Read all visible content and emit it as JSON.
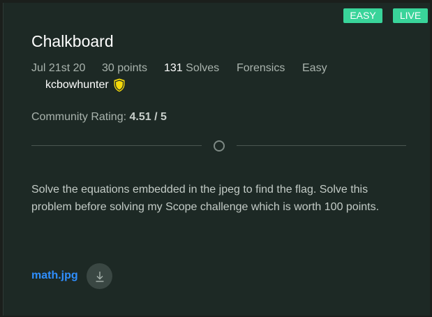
{
  "badges": {
    "easy": "EASY",
    "live": "LIVE"
  },
  "challenge": {
    "title": "Chalkboard",
    "date": "Jul 21st 20",
    "points": "30 points",
    "solves_count": "131",
    "solves_label": "Solves",
    "category": "Forensics",
    "difficulty": "Easy",
    "author": "kcbowhunter",
    "rating_label": "Community Rating:",
    "rating_value": "4.51 / 5",
    "description": "Solve the equations embedded in the jpeg to find the flag. Solve this problem before solving my Scope challenge which is worth 100 points.",
    "file_name": "math.jpg"
  },
  "icons": {
    "author_badge": "shield-icon",
    "download": "download-icon",
    "divider": "circle-icon"
  },
  "colors": {
    "accent": "#39d49a",
    "link": "#2f8fff",
    "card_bg": "#1d2925",
    "shield": "#f5d90a"
  }
}
